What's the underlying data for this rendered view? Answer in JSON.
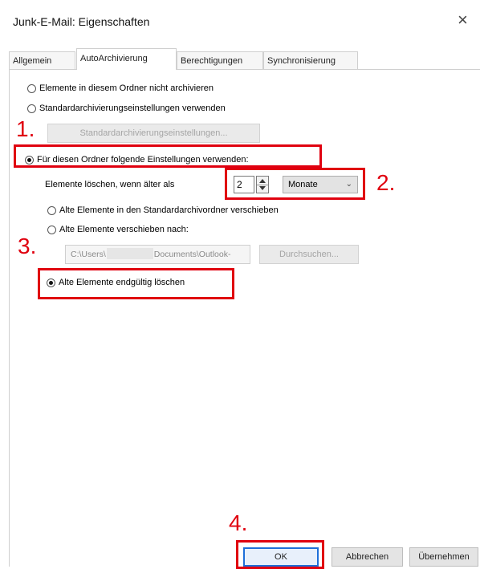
{
  "window": {
    "title": "Junk-E-Mail: Eigenschaften",
    "close_glyph": "×"
  },
  "tabs": [
    {
      "label": "Allgemein",
      "active": false
    },
    {
      "label": "AutoArchivierung",
      "active": true
    },
    {
      "label": "Berechtigungen",
      "active": false
    },
    {
      "label": "Synchronisierung",
      "active": false
    }
  ],
  "options": {
    "no_archive": {
      "label": "Elemente in diesem Ordner nicht archivieren",
      "checked": false
    },
    "default_settings": {
      "label": "Standardarchivierungseinstellungen verwenden",
      "checked": false
    },
    "default_settings_button": "Standardarchivierungseinstellungen...",
    "custom_settings": {
      "label": "Für diesen Ordner folgende Einstellungen verwenden:",
      "checked": true
    },
    "delete_older_label": "Elemente löschen, wenn älter als",
    "age_value": "2",
    "age_unit": "Monate",
    "move_default": {
      "label": "Alte Elemente in den Standardarchivordner verschieben",
      "checked": false
    },
    "move_to": {
      "label": "Alte Elemente verschieben nach:",
      "checked": false
    },
    "path_prefix": "C:\\Users\\",
    "path_suffix": "Documents\\Outlook-",
    "browse_button": "Durchsuchen...",
    "delete_permanent": {
      "label": "Alte Elemente endgültig löschen",
      "checked": true
    }
  },
  "footer": {
    "ok": "OK",
    "cancel": "Abbrechen",
    "apply": "Übernehmen"
  },
  "annotations": {
    "step1": "1.",
    "step2": "2.",
    "step3": "3.",
    "step4": "4.",
    "color": "#e0000f"
  },
  "colors": {
    "focus_blue": "#1e6fd9"
  }
}
